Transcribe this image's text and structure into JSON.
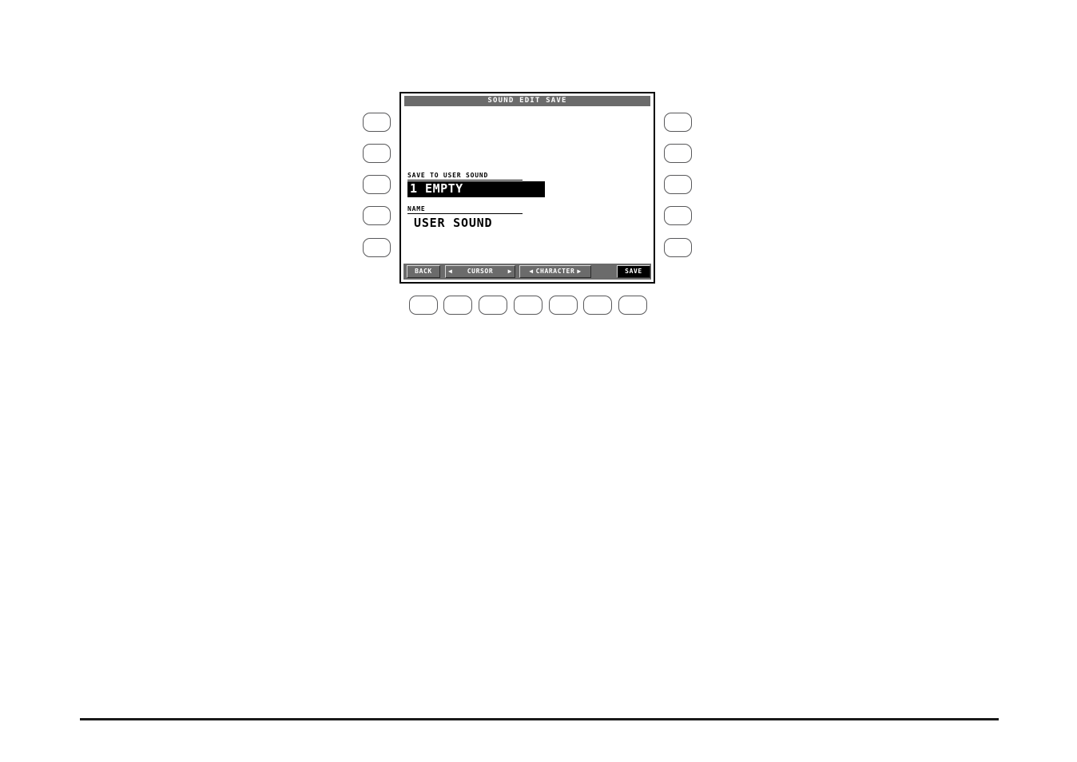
{
  "screen": {
    "title": "SOUND EDIT SAVE",
    "fields": [
      {
        "label": "SAVE TO USER SOUND",
        "value": "1 EMPTY",
        "state": "selected"
      },
      {
        "label": "NAME",
        "value": "USER SOUND",
        "state": "normal"
      }
    ],
    "softkeys": [
      {
        "label": "BACK",
        "left_arrow": "",
        "right_arrow": "",
        "selected": false
      },
      {
        "label": "CURSOR",
        "left_arrow": "◀",
        "right_arrow": "▶",
        "selected": false
      },
      {
        "label": "CHARACTER",
        "left_arrow": "◀",
        "right_arrow": "▶",
        "selected": false
      },
      {
        "label": "SAVE",
        "left_arrow": "",
        "right_arrow": "",
        "selected": true
      }
    ]
  },
  "colors": {
    "lcd_gray": "#6b6b6b",
    "lcd_black": "#000000",
    "lcd_white": "#ffffff",
    "bezel": "#000000",
    "button_outline": "#58585a"
  }
}
